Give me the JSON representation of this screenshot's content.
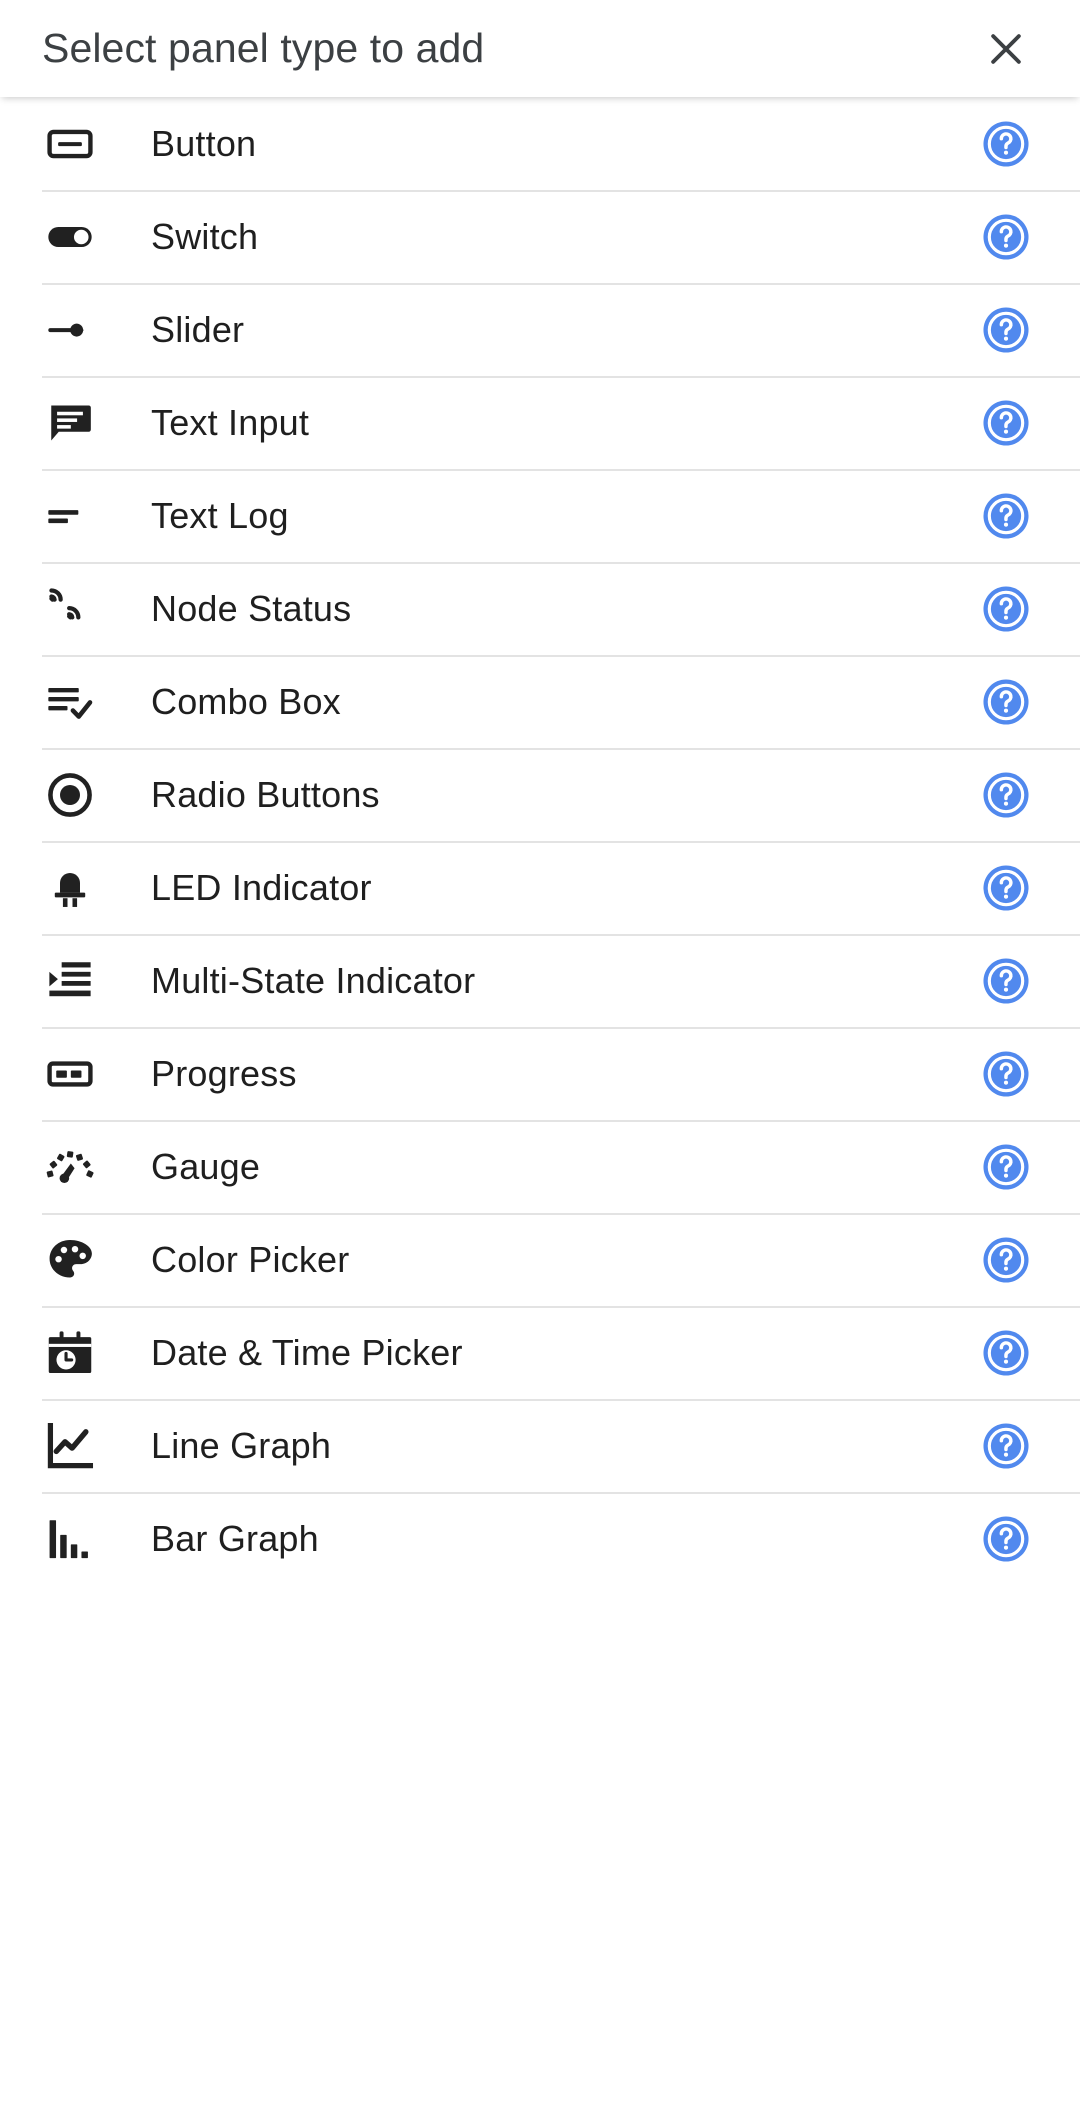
{
  "dialog": {
    "title": "Select panel type to add",
    "close_label": "×",
    "close_icon": "close-icon"
  },
  "colors": {
    "help_blue": "#5189ee",
    "title_text": "#3c4043",
    "label_text": "#1f1f1f",
    "separator": "#e3e3e3",
    "icon": "#212121",
    "background": "#ffffff"
  },
  "list": {
    "help_icon_name": "help-circle-icon",
    "items": [
      {
        "label": "Button",
        "icon": "button-icon"
      },
      {
        "label": "Switch",
        "icon": "toggle-switch-icon"
      },
      {
        "label": "Slider",
        "icon": "slider-icon"
      },
      {
        "label": "Text Input",
        "icon": "text-input-icon"
      },
      {
        "label": "Text Log",
        "icon": "text-log-icon"
      },
      {
        "label": "Node Status",
        "icon": "node-status-icon"
      },
      {
        "label": "Combo Box",
        "icon": "combo-box-icon"
      },
      {
        "label": "Radio Buttons",
        "icon": "radio-button-icon"
      },
      {
        "label": "LED Indicator",
        "icon": "led-indicator-icon"
      },
      {
        "label": "Multi-State Indicator",
        "icon": "multi-state-indicator-icon"
      },
      {
        "label": "Progress",
        "icon": "progress-icon"
      },
      {
        "label": "Gauge",
        "icon": "gauge-icon"
      },
      {
        "label": "Color Picker",
        "icon": "color-palette-icon"
      },
      {
        "label": "Date & Time Picker",
        "icon": "calendar-clock-icon"
      },
      {
        "label": "Line Graph",
        "icon": "line-graph-icon"
      },
      {
        "label": "Bar Graph",
        "icon": "bar-graph-icon"
      }
    ]
  }
}
